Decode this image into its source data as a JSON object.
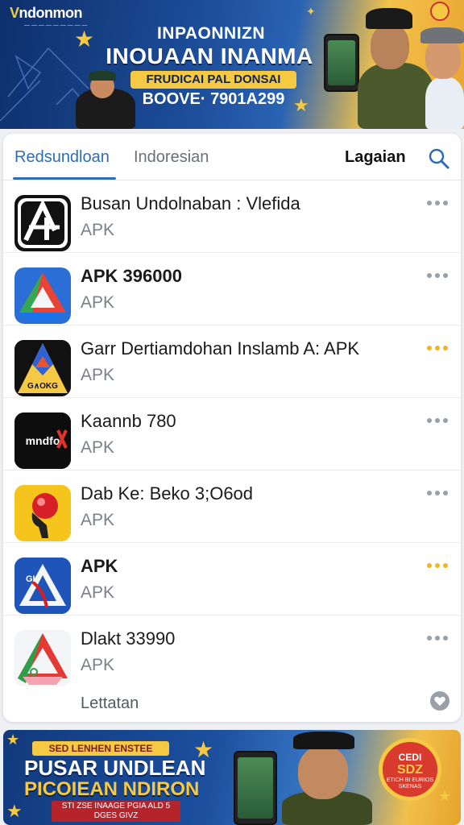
{
  "top_banner": {
    "brand": "ndonmon",
    "brand_sub": "— — — — — — — — —",
    "title_line1": "INPAONNIZN",
    "title_line2": "INOUAAN INANMA",
    "pill": "FRUDICAI PAL DONSAI",
    "sub": "BOOVE· 7901A299"
  },
  "tabs": [
    {
      "label": "Redsundloan",
      "active": true
    },
    {
      "label": "Indoresian",
      "active": false
    },
    {
      "label": "Lagaian",
      "active": false
    }
  ],
  "search_icon": "search-icon",
  "apps": [
    {
      "title": "Busan Undolnaban : Vlefida",
      "sub": "APK",
      "bold": false,
      "more_accent": false,
      "icon": "ai-logo-icon"
    },
    {
      "title": "APK 396000",
      "sub": "APK",
      "bold": true,
      "more_accent": false,
      "icon": "drive-triangle-icon"
    },
    {
      "title": "Garr Dertiamdohan  Inslamb A: APK",
      "sub": "APK",
      "bold": false,
      "more_accent": true,
      "icon": "yellow-black-logo-icon"
    },
    {
      "title": "Kaannb 780",
      "sub": "APK",
      "bold": false,
      "more_accent": false,
      "icon": "mndfox-logo-icon"
    },
    {
      "title": "Dab Ke: Beko 3;O6od",
      "sub": "APK",
      "bold": false,
      "more_accent": false,
      "icon": "red-ball-icon"
    },
    {
      "title": "APK",
      "sub": "APK",
      "bold": true,
      "more_accent": true,
      "icon": "blue-warning-icon"
    },
    {
      "title": "Dlakt 33990",
      "sub": "APK",
      "bold": false,
      "more_accent": false,
      "icon": "green-red-triangle-icon"
    }
  ],
  "footer_label": "Lettatan",
  "heart_icon": "heart-icon",
  "bottom_banner": {
    "pill": "SED LENHEN ENSTEE",
    "title_line1": "PUSAR UNDLEAN",
    "title_line2": "PICOIEAN NDIRON",
    "note": "STI ZSE INAAGE PGIA ALD 5 DGES GIVZ",
    "badge_line1": "CEDI",
    "badge_line2": "SDZ",
    "badge_line3": "ETICH BI EURIOS SKENAS"
  },
  "colors": {
    "accent": "#2d6db5",
    "gold": "#f6c945",
    "more_accent": "#f0b429"
  }
}
